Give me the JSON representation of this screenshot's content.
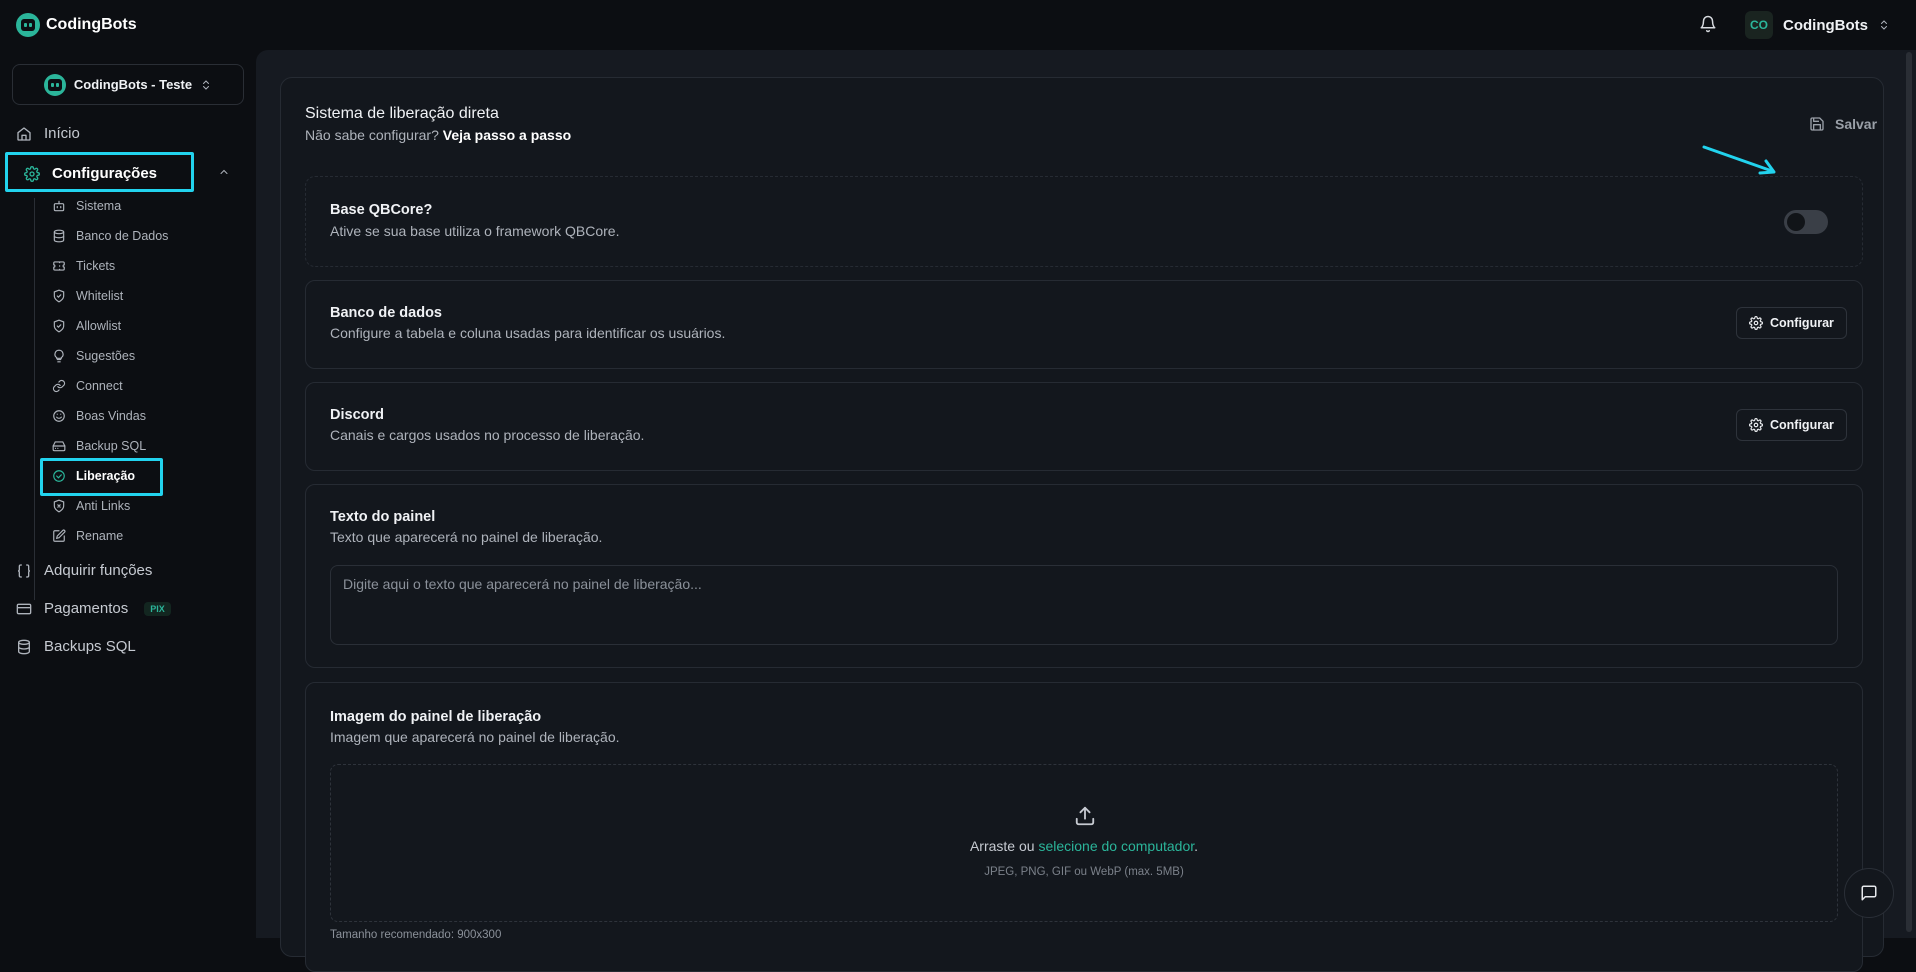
{
  "header": {
    "brand": "CodingBots",
    "user_initials": "CO",
    "user_name": "CodingBots"
  },
  "sidebar": {
    "org_name": "CodingBots - Teste",
    "items": [
      {
        "label": "Início"
      },
      {
        "label": "Configurações"
      },
      {
        "label": "Adquirir funções"
      },
      {
        "label": "Pagamentos",
        "badge": "PIX"
      },
      {
        "label": "Backups SQL"
      }
    ],
    "sub_items": [
      {
        "label": "Sistema"
      },
      {
        "label": "Banco de Dados"
      },
      {
        "label": "Tickets"
      },
      {
        "label": "Whitelist"
      },
      {
        "label": "Allowlist"
      },
      {
        "label": "Sugestões"
      },
      {
        "label": "Connect"
      },
      {
        "label": "Boas Vindas"
      },
      {
        "label": "Backup SQL"
      },
      {
        "label": "Liberação"
      },
      {
        "label": "Anti Links"
      },
      {
        "label": "Rename"
      }
    ]
  },
  "main": {
    "title": "Sistema de liberação direta",
    "subtitle_prefix": "Não sabe configurar?",
    "subtitle_link": "Veja passo a passo",
    "save_label": "Salvar",
    "cards": {
      "qbcore": {
        "title": "Base QBCore?",
        "desc": "Ative se sua base utiliza o framework QBCore.",
        "enabled": false
      },
      "database": {
        "title": "Banco de dados",
        "desc": "Configure a tabela e coluna usadas para identificar os usuários.",
        "button": "Configurar"
      },
      "discord": {
        "title": "Discord",
        "desc": "Canais e cargos usados no processo de liberação.",
        "button": "Configurar"
      },
      "panel_text": {
        "title": "Texto do painel",
        "desc": "Texto que aparecerá no painel de liberação.",
        "placeholder": "Digite aqui o texto que aparecerá no painel de liberação..."
      },
      "panel_image": {
        "title": "Imagem do painel de liberação",
        "desc": "Imagem que aparecerá no painel de liberação.",
        "drop_prefix": "Arraste ou",
        "drop_link": "selecione do computador",
        "drop_suffix": ".",
        "hint": "JPEG, PNG, GIF ou WebP (max. 5MB)",
        "recommended": "Tamanho recomendado: 900x300"
      }
    }
  },
  "colors": {
    "accent": "#2bb59a",
    "highlight": "#22d3ee"
  }
}
